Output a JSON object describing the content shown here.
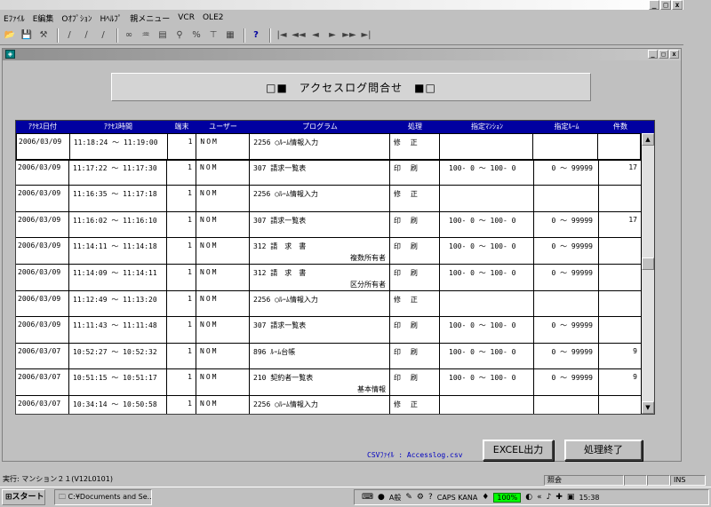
{
  "window": {
    "min": "_",
    "max": "□",
    "close": "x"
  },
  "menubar": [
    "Eﾌｧｲﾙ",
    "E編集",
    "Oｵﾌﾟｼｮﾝ",
    "Hﾍﾙﾌﾟ",
    "親メニュー",
    "VCR",
    "OLE2"
  ],
  "toolbar": {
    "icons": [
      "open-icon",
      "save-icon",
      "tools-icon",
      "pen-icon",
      "pen2-icon",
      "pen3-icon",
      "binoculars-icon",
      "replace-icon",
      "print-icon",
      "search-icon",
      "format-icon",
      "filter-icon",
      "grid-icon",
      "help-icon",
      "first-icon",
      "prev-page-icon",
      "prev-icon",
      "next-icon",
      "next-page-icon",
      "last-icon"
    ],
    "help": "?",
    "nav": [
      "|◄",
      "◄◄",
      "◄",
      "►",
      "►►",
      "►|"
    ]
  },
  "child": {
    "min": "_",
    "max": "□",
    "close": "x"
  },
  "title": "□■　アクセスログ問合せ　■□",
  "grid": {
    "headers": [
      "ｱｸｾｽ日付",
      "ｱｸｾｽ時間",
      "端末",
      "ユーザー",
      "プログラム",
      "処理",
      "指定ﾏﾝｼｮﾝ",
      "指定ﾙｰﾑ",
      "件数"
    ],
    "rows": [
      {
        "date": "2006/03/09",
        "time": "11:18:24 ～ 11:19:00",
        "term": "1",
        "user": "NOM",
        "prog": "2256 ○ﾙｰﾑ情報入力",
        "sub": "",
        "proc": "修 正",
        "mans": "",
        "room": "",
        "cnt": ""
      },
      {
        "date": "2006/03/09",
        "time": "11:17:22 ～ 11:17:30",
        "term": "1",
        "user": "NOM",
        "prog": " 307 請求一覧表",
        "sub": "",
        "proc": "印 刷",
        "mans": "100- 0 ～  100- 0",
        "room": "0 ～ 99999",
        "cnt": "17"
      },
      {
        "date": "2006/03/09",
        "time": "11:16:35 ～ 11:17:18",
        "term": "1",
        "user": "NOM",
        "prog": "2256 ○ﾙｰﾑ情報入力",
        "sub": "",
        "proc": "修 正",
        "mans": "",
        "room": "",
        "cnt": ""
      },
      {
        "date": "2006/03/09",
        "time": "11:16:02 ～ 11:16:10",
        "term": "1",
        "user": "NOM",
        "prog": " 307 請求一覧表",
        "sub": "",
        "proc": "印 刷",
        "mans": "100- 0 ～  100- 0",
        "room": "0 ～ 99999",
        "cnt": "17"
      },
      {
        "date": "2006/03/09",
        "time": "11:14:11 ～ 11:14:18",
        "term": "1",
        "user": "NOM",
        "prog": " 312 請　求　書",
        "sub": "複数所有者",
        "proc": "印 刷",
        "mans": "100- 0 ～  100- 0",
        "room": "0 ～ 99999",
        "cnt": ""
      },
      {
        "date": "2006/03/09",
        "time": "11:14:09 ～ 11:14:11",
        "term": "1",
        "user": "NOM",
        "prog": " 312 請　求　書",
        "sub": "区分所有者",
        "proc": "印 刷",
        "mans": "100- 0 ～  100- 0",
        "room": "0 ～ 99999",
        "cnt": ""
      },
      {
        "date": "2006/03/09",
        "time": "11:12:49 ～ 11:13:20",
        "term": "1",
        "user": "NOM",
        "prog": "2256 ○ﾙｰﾑ情報入力",
        "sub": "",
        "proc": "修 正",
        "mans": "",
        "room": "",
        "cnt": ""
      },
      {
        "date": "2006/03/09",
        "time": "11:11:43 ～ 11:11:48",
        "term": "1",
        "user": "NOM",
        "prog": " 307 請求一覧表",
        "sub": "",
        "proc": "印 刷",
        "mans": "100- 0 ～  100- 0",
        "room": "0 ～ 99999",
        "cnt": ""
      },
      {
        "date": "2006/03/07",
        "time": "10:52:27 ～ 10:52:32",
        "term": "1",
        "user": "NOM",
        "prog": " 896 ﾙｰﾑ台帳",
        "sub": "",
        "proc": "印 刷",
        "mans": "100- 0 ～  100- 0",
        "room": "0 ～ 99999",
        "cnt": "9"
      },
      {
        "date": "2006/03/07",
        "time": "10:51:15 ～ 10:51:17",
        "term": "1",
        "user": "NOM",
        "prog": " 210 契約者一覧表",
        "sub": "基本情報",
        "proc": "印 刷",
        "mans": "100- 0 ～  100- 0",
        "room": "0 ～ 99999",
        "cnt": "9"
      },
      {
        "date": "2006/03/07",
        "time": "10:34:14 ～ 10:50:58",
        "term": "1",
        "user": "NOM",
        "prog": "2256 ○ﾙｰﾑ情報入力",
        "sub": "",
        "proc": "修 正",
        "mans": "",
        "room": "",
        "cnt": ""
      }
    ]
  },
  "csv_label": "CSVﾌｧｲﾙ : Accesslog.csv",
  "buttons": {
    "excel": "EXCEL出力",
    "close": "処理終了"
  },
  "status": {
    "exec": "実行: マンション２１(V12L0101)",
    "mode": "照会",
    "ins": "INS"
  },
  "taskbar": {
    "start": "スタート",
    "task": "C:¥Documents and Se...",
    "ime": "A般",
    "caps": "CAPS KANA",
    "zoom": "100%",
    "clock": "15:38"
  }
}
